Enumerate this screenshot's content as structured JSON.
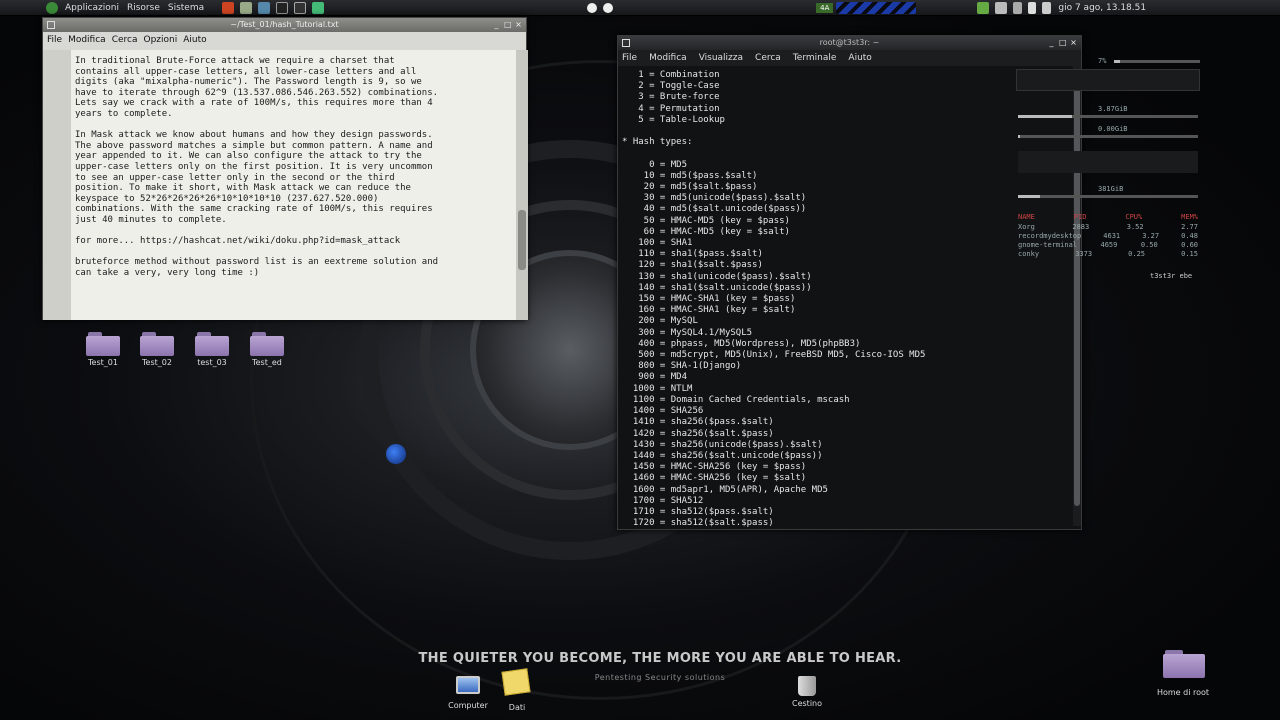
{
  "top_panel": {
    "menus": [
      "Applicazioni",
      "Risorse",
      "Sistema"
    ],
    "workspace": "4A",
    "clock": "gio 7 ago, 13.18.51"
  },
  "editor": {
    "title": "~/Test_01/hash_Tutorial.txt",
    "menu": [
      "File",
      "Modifica",
      "Cerca",
      "Opzioni",
      "Aiuto"
    ],
    "lines": [
      "In traditional Brute-Force attack we require a charset that",
      "contains all upper-case letters, all lower-case letters and all",
      "digits (aka \"mixalpha-numeric\"). The Password length is 9, so we",
      "have to iterate through 62^9 (13.537.086.546.263.552) combinations.",
      "Lets say we crack with a rate of 100M/s, this requires more than 4",
      "years to complete.",
      "",
      "In Mask attack we know about humans and how they design passwords.",
      "The above password matches a simple but common pattern. A name and",
      "year appended to it. We can also configure the attack to try the",
      "upper-case letters only on the first position. It is very uncommon",
      "to see an upper-case letter only in the second or the third",
      "position. To make it short, with Mask attack we can reduce the",
      "keyspace to 52*26*26*26*26*10*10*10*10 (237.627.520.000)",
      "combinations. With the same cracking rate of 100M/s, this requires",
      "just 40 minutes to complete.",
      "",
      "for more... https://hashcat.net/wiki/doku.php?id=mask_attack",
      "",
      "bruteforce method without password list is an eextreme solution and",
      "can take a very, very long time :)"
    ]
  },
  "terminal": {
    "title": "root@t3st3r: ~",
    "menu": [
      "File",
      "Modifica",
      "Visualizza",
      "Cerca",
      "Terminale",
      "Aiuto"
    ],
    "lines": [
      "   1 = Combination",
      "   2 = Toggle-Case",
      "   3 = Brute-force",
      "   4 = Permutation",
      "   5 = Table-Lookup",
      "",
      "* Hash types:",
      "",
      "     0 = MD5",
      "    10 = md5($pass.$salt)",
      "    20 = md5($salt.$pass)",
      "    30 = md5(unicode($pass).$salt)",
      "    40 = md5($salt.unicode($pass))",
      "    50 = HMAC-MD5 (key = $pass)",
      "    60 = HMAC-MD5 (key = $salt)",
      "   100 = SHA1",
      "   110 = sha1($pass.$salt)",
      "   120 = sha1($salt.$pass)",
      "   130 = sha1(unicode($pass).$salt)",
      "   140 = sha1($salt.unicode($pass))",
      "   150 = HMAC-SHA1 (key = $pass)",
      "   160 = HMAC-SHA1 (key = $salt)",
      "   200 = MySQL",
      "   300 = MySQL4.1/MySQL5",
      "   400 = phpass, MD5(Wordpress), MD5(phpBB3)",
      "   500 = md5crypt, MD5(Unix), FreeBSD MD5, Cisco-IOS MD5",
      "   800 = SHA-1(Django)",
      "   900 = MD4",
      "  1000 = NTLM",
      "  1100 = Domain Cached Credentials, mscash",
      "  1400 = SHA256",
      "  1410 = sha256($pass.$salt)",
      "  1420 = sha256($salt.$pass)",
      "  1430 = sha256(unicode($pass).$salt)",
      "  1440 = sha256($salt.unicode($pass))",
      "  1450 = HMAC-SHA256 (key = $pass)",
      "  1460 = HMAC-SHA256 (key = $salt)",
      "  1600 = md5apr1, MD5(APR), Apache MD5",
      "  1700 = SHA512",
      "  1710 = sha512($pass.$salt)",
      "  1720 = sha512($salt.$pass)"
    ]
  },
  "conky": {
    "cpu_percent": "7%",
    "ram": "3.87GiB",
    "swap": "0.00GiB",
    "disk": "381GiB",
    "processes_header": [
      "NAME",
      "PID",
      "CPU%",
      "MEM%"
    ],
    "processes": [
      [
        "Xorg",
        "2883",
        "3.52",
        "2.77"
      ],
      [
        "recordmydesktop",
        "4631",
        "3.27",
        "0.48"
      ],
      [
        "gnome-terminal",
        "4659",
        "0.50",
        "0.60"
      ],
      [
        "conky",
        "3373",
        "0.25",
        "0.15"
      ]
    ],
    "user": "t3st3r ebe"
  },
  "desktop": {
    "folders": [
      "Test_01",
      "Test_02",
      "test_03",
      "Test_ed"
    ],
    "bottom_icons": [
      "Computer",
      "Dati",
      "Cestino"
    ],
    "home_icon": "Home di root",
    "tagline": "THE QUIETER YOU BECOME, THE MORE YOU ARE ABLE TO HEAR.",
    "subtag": "Pentesting Security solutions"
  },
  "colors": {
    "accent_blue": "#2a6de0",
    "folder": "#a894c8"
  }
}
